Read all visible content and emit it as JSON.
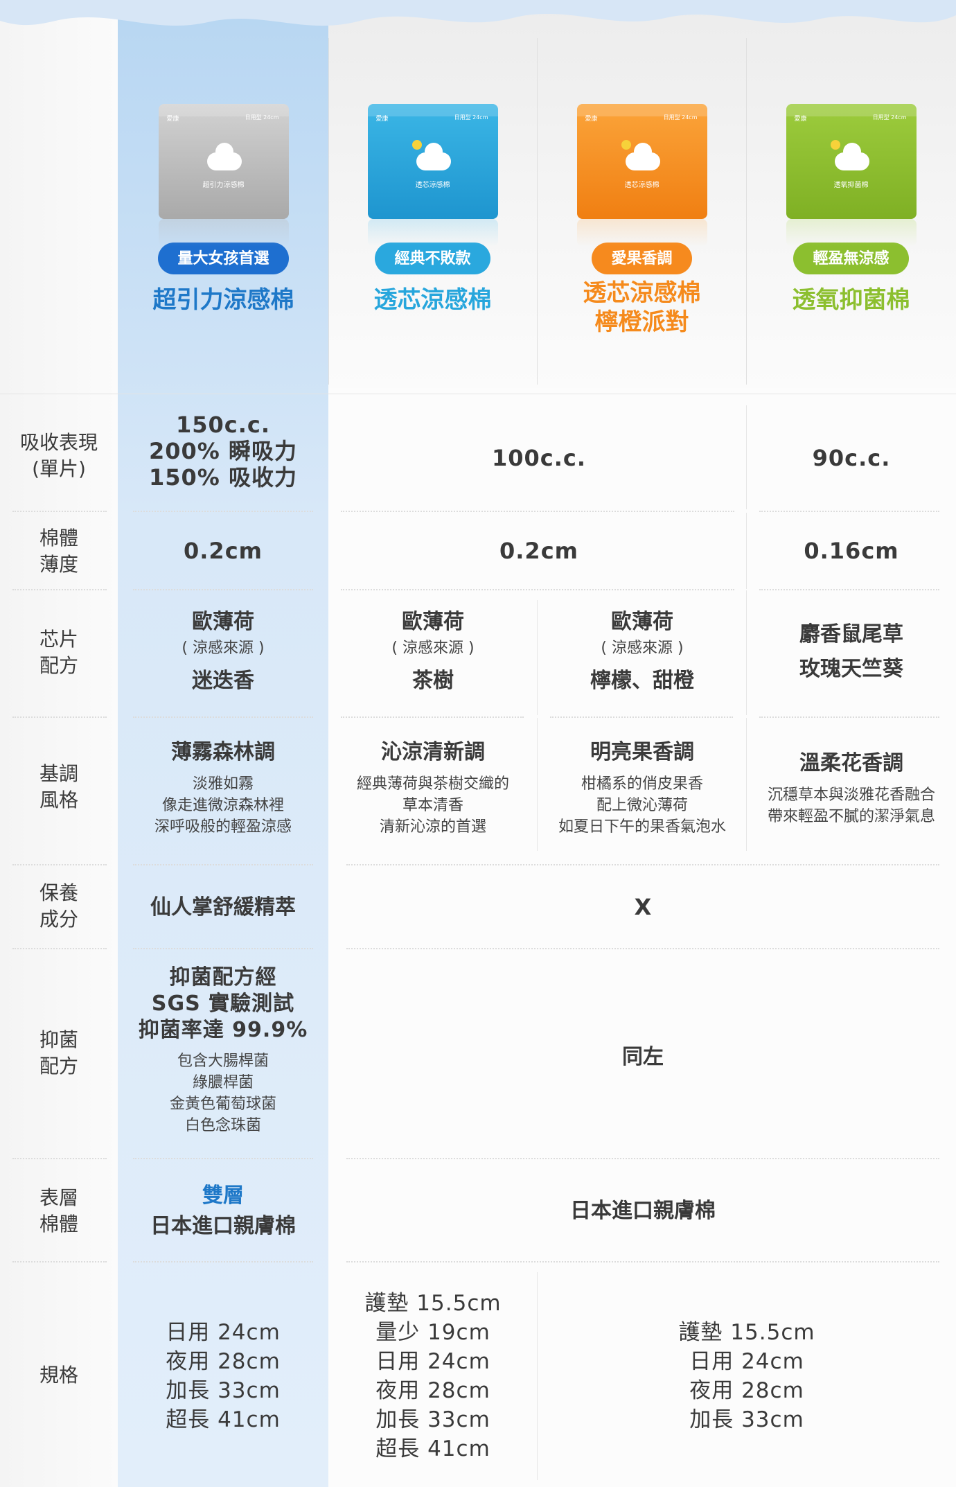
{
  "colors": {
    "highlight_column": "#cfe3f6",
    "blue_accent": "#1e78c8",
    "teal_product": "#27a6dc",
    "orange_product": "#f58a1c",
    "green_product": "#8cbf2f",
    "silver_product": "#b8b8b8"
  },
  "products": [
    {
      "pack_name": "超引力涼感棉",
      "pack_spec": "日用型 24cm",
      "pack_brand": "愛康",
      "tag": "量大女孩首選",
      "name_line1": "超引力涼感棉",
      "name_line2": "",
      "tag_color": "#1e6fd0",
      "name_color": "#1e78c8"
    },
    {
      "pack_name": "透芯涼感棉",
      "pack_spec": "日用型 24cm",
      "pack_brand": "愛康",
      "tag": "經典不敗款",
      "name_line1": "透芯涼感棉",
      "name_line2": "",
      "tag_color": "#2aa8de",
      "name_color": "#27a6dc"
    },
    {
      "pack_name": "透芯涼感棉",
      "pack_spec": "日用型 24cm",
      "pack_brand": "愛康",
      "tag": "愛果香調",
      "name_line1": "透芯涼感棉",
      "name_line2": "檸橙派對",
      "tag_color": "#f68a1e",
      "name_color": "#f58a1c"
    },
    {
      "pack_name": "透氧抑菌棉",
      "pack_spec": "日用型 24cm",
      "pack_brand": "愛康",
      "tag": "輕盈無涼感",
      "name_line1": "透氧抑菌棉",
      "name_line2": "",
      "tag_color": "#8cbf2f",
      "name_color": "#8cbf2f"
    }
  ],
  "rows": {
    "absorption": {
      "label": "吸收表現\n(單片)",
      "c1": "150c.c.\n200% 瞬吸力\n150% 吸收力",
      "c23": "100c.c.",
      "c4": "90c.c."
    },
    "thickness": {
      "label": "棉體\n薄度",
      "c1": "0.2cm",
      "c23": "0.2cm",
      "c4": "0.16cm"
    },
    "chip": {
      "label": "芯片\n配方",
      "c1_a": "歐薄荷",
      "c1_b": "( 涼感來源 )",
      "c1_c": "迷迭香",
      "c2_a": "歐薄荷",
      "c2_b": "( 涼感來源 )",
      "c2_c": "茶樹",
      "c3_a": "歐薄荷",
      "c3_b": "( 涼感來源 )",
      "c3_c": "檸檬、甜橙",
      "c4_a": "麝香鼠尾草",
      "c4_b": "玫瑰天竺葵"
    },
    "tone": {
      "label": "基調\n風格",
      "c1_title": "薄霧森林調",
      "c1_desc": "淡雅如霧\n像走進微涼森林裡\n深呼吸般的輕盈涼感",
      "c2_title": "沁涼清新調",
      "c2_desc": "經典薄荷與茶樹交織的\n草本清香\n清新沁涼的首選",
      "c3_title": "明亮果香調",
      "c3_desc": "柑橘系的俏皮果香\n配上微沁薄荷\n如夏日下午的果香氣泡水",
      "c4_title": "溫柔花香調",
      "c4_desc": "沉穩草本與淡雅花香融合\n帶來輕盈不膩的潔淨氣息"
    },
    "care": {
      "label": "保養\n成分",
      "c1": "仙人掌舒緩精萃",
      "c234": "X"
    },
    "antibac": {
      "label": "抑菌\n配方",
      "c1_title": "抑菌配方經\nSGS 實驗測試\n抑菌率達 99.9%",
      "c1_desc": "包含大腸桿菌\n綠膿桿菌\n金黃色葡萄球菌\n白色念珠菌",
      "c234": "同左"
    },
    "surface": {
      "label": "表層\n棉體",
      "c1_a": "雙層",
      "c1_b": "日本進口親膚棉",
      "c234": "日本進口親膚棉"
    },
    "sizes": {
      "label": "規格",
      "c1": "日用 24cm\n夜用 28cm\n加長 33cm\n超長 41cm",
      "c2": "護墊 15.5cm\n量少 19cm\n日用 24cm\n夜用 28cm\n加長 33cm\n超長 41cm",
      "c34": "護墊 15.5cm\n日用 24cm\n夜用 28cm\n加長 33cm"
    }
  }
}
